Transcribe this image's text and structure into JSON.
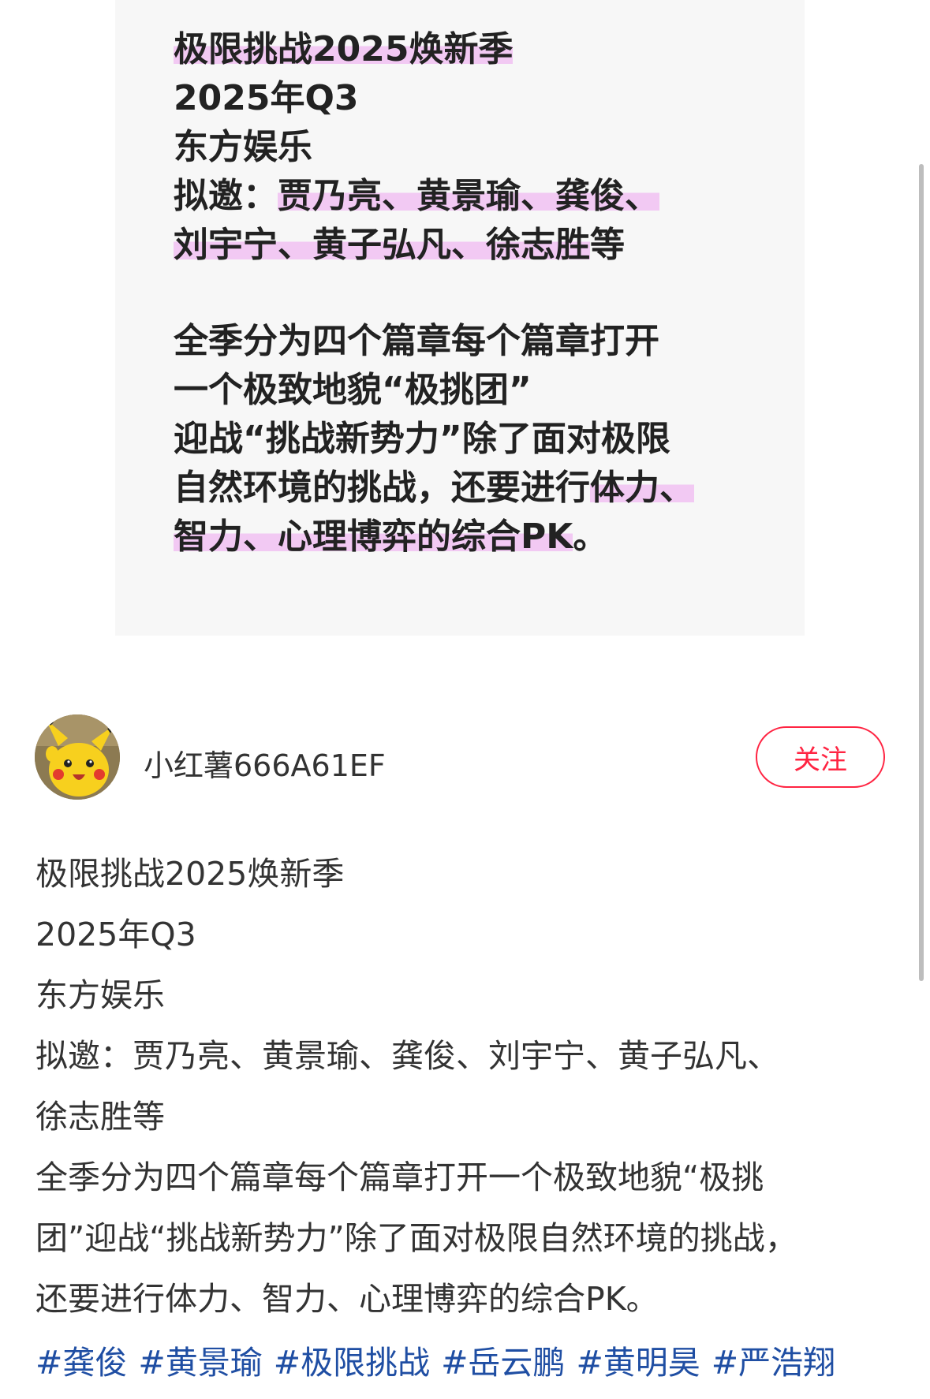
{
  "image_card": {
    "lines": [
      {
        "pre": "",
        "hl": "极限挑战2025焕新季",
        "post": ""
      },
      {
        "pre": "2025年Q3",
        "hl": "",
        "post": ""
      },
      {
        "pre": "东方娱乐",
        "hl": "",
        "post": ""
      },
      {
        "pre": "拟邀：",
        "hl": "贾乃亮、黄景瑜、龚俊、",
        "post": ""
      },
      {
        "pre": "",
        "hl": "刘宇宁、黄子弘凡、徐志胜",
        "post": "等"
      },
      {
        "gap": true
      },
      {
        "pre": "全季分为四个篇章每个篇章打开",
        "hl": "",
        "post": ""
      },
      {
        "pre": "一个极致地貌“极挑团”",
        "hl": "",
        "post": ""
      },
      {
        "pre": "迎战“挑战新势力”除了面对极限",
        "hl": "",
        "post": ""
      },
      {
        "pre": "自然环境的挑战，还要进行",
        "hl": "体力、",
        "post": ""
      },
      {
        "pre": "",
        "hl": "智力、心理博弈的综合PK",
        "post": "。"
      }
    ]
  },
  "author": {
    "name": "小红薯666A61EF",
    "avatar_icon": "pikachu-avatar-icon"
  },
  "follow_label": "关注",
  "post": {
    "lines": [
      "极限挑战2025焕新季",
      "2025年Q3",
      "东方娱乐",
      "拟邀：贾乃亮、黄景瑜、龚俊、刘宇宁、黄子弘凡、",
      "徐志胜等",
      "全季分为四个篇章每个篇章打开一个极致地貌“极挑",
      "团”迎战“挑战新势力”除了面对极限自然环境的挑战，",
      "还要进行体力、智力、心理博弈的综合PK。"
    ],
    "tags": [
      "#龚俊",
      "#黄景瑜",
      "#极限挑战",
      "#岳云鹏",
      "#黄明昊",
      "#严浩翔"
    ]
  },
  "colors": {
    "accent": "#ff2442",
    "tag": "#1f4ea3",
    "highlight": "#f2c9f3"
  }
}
